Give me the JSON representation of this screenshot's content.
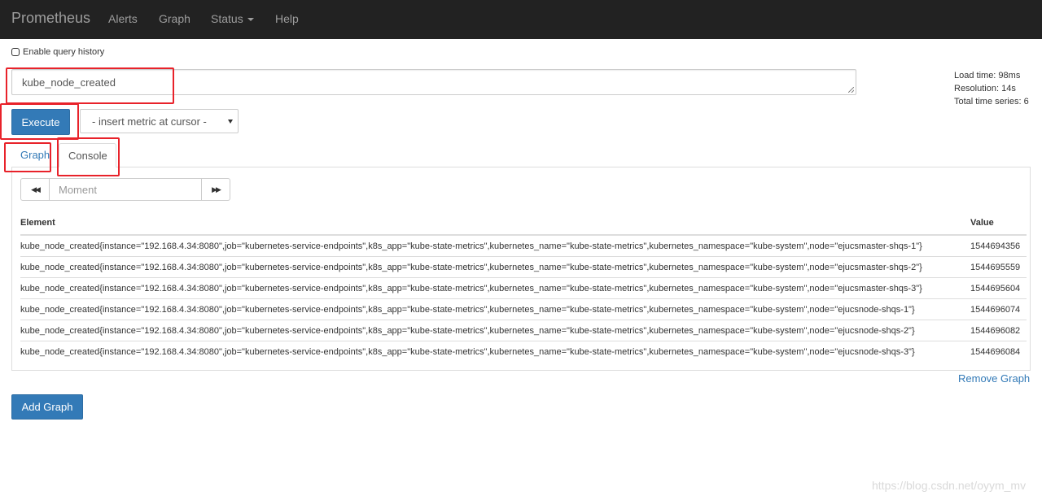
{
  "navbar": {
    "brand": "Prometheus",
    "links": [
      "Alerts",
      "Graph",
      "Status",
      "Help"
    ]
  },
  "query_history_label": "Enable query history",
  "expression": {
    "value": "kube_node_created"
  },
  "stats": {
    "load_time": "Load time: 98ms",
    "resolution": "Resolution: 14s",
    "total_series": "Total time series: 6"
  },
  "execute_label": "Execute",
  "metric_select": {
    "selected": "- insert metric at cursor -"
  },
  "tabs": {
    "graph": "Graph",
    "console": "Console"
  },
  "console": {
    "moment_placeholder": "Moment",
    "back_icon": "fast-backward-icon",
    "forward_icon": "fast-forward-icon",
    "headers": {
      "element": "Element",
      "value": "Value"
    },
    "rows": [
      {
        "element": "kube_node_created{instance=\"192.168.4.34:8080\",job=\"kubernetes-service-endpoints\",k8s_app=\"kube-state-metrics\",kubernetes_name=\"kube-state-metrics\",kubernetes_namespace=\"kube-system\",node=\"ejucsmaster-shqs-1\"}",
        "value": "1544694356"
      },
      {
        "element": "kube_node_created{instance=\"192.168.4.34:8080\",job=\"kubernetes-service-endpoints\",k8s_app=\"kube-state-metrics\",kubernetes_name=\"kube-state-metrics\",kubernetes_namespace=\"kube-system\",node=\"ejucsmaster-shqs-2\"}",
        "value": "1544695559"
      },
      {
        "element": "kube_node_created{instance=\"192.168.4.34:8080\",job=\"kubernetes-service-endpoints\",k8s_app=\"kube-state-metrics\",kubernetes_name=\"kube-state-metrics\",kubernetes_namespace=\"kube-system\",node=\"ejucsmaster-shqs-3\"}",
        "value": "1544695604"
      },
      {
        "element": "kube_node_created{instance=\"192.168.4.34:8080\",job=\"kubernetes-service-endpoints\",k8s_app=\"kube-state-metrics\",kubernetes_name=\"kube-state-metrics\",kubernetes_namespace=\"kube-system\",node=\"ejucsnode-shqs-1\"}",
        "value": "1544696074"
      },
      {
        "element": "kube_node_created{instance=\"192.168.4.34:8080\",job=\"kubernetes-service-endpoints\",k8s_app=\"kube-state-metrics\",kubernetes_name=\"kube-state-metrics\",kubernetes_namespace=\"kube-system\",node=\"ejucsnode-shqs-2\"}",
        "value": "1544696082"
      },
      {
        "element": "kube_node_created{instance=\"192.168.4.34:8080\",job=\"kubernetes-service-endpoints\",k8s_app=\"kube-state-metrics\",kubernetes_name=\"kube-state-metrics\",kubernetes_namespace=\"kube-system\",node=\"ejucsnode-shqs-3\"}",
        "value": "1544696084"
      }
    ]
  },
  "remove_graph_label": "Remove Graph",
  "add_graph_label": "Add Graph",
  "watermark": "https://blog.csdn.net/oyym_mv",
  "colors": {
    "navbar_bg": "#222222",
    "primary": "#337ab7",
    "annotation": "#e8222a"
  }
}
